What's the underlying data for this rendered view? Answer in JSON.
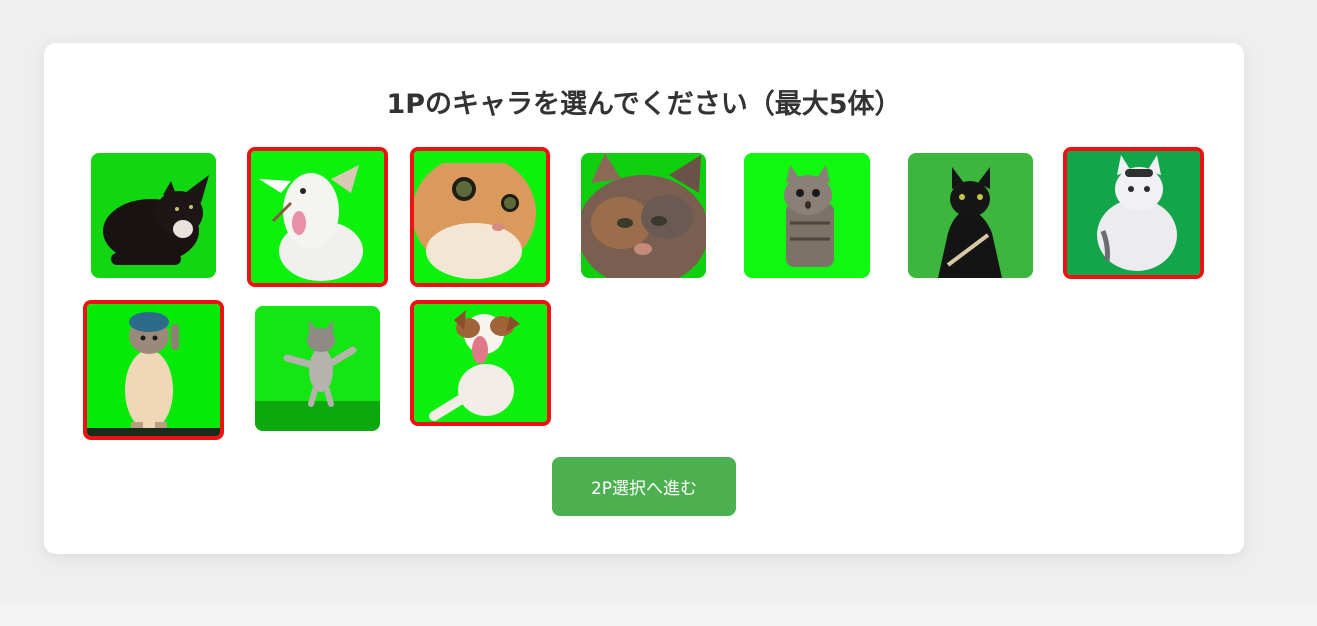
{
  "page": {
    "title": "1Pのキャラを選んでください（最大5体）",
    "next_button_label": "2P選択へ進む",
    "max_selection": 5
  },
  "characters": [
    {
      "id": 1,
      "name": "black-cat-lying-icon",
      "selected": false,
      "bg": "#11d611"
    },
    {
      "id": 2,
      "name": "goat-tongue-icon",
      "selected": true,
      "bg": "#0cf20c"
    },
    {
      "id": 3,
      "name": "orange-cat-closeup-icon",
      "selected": true,
      "bg": "#0cf20c"
    },
    {
      "id": 4,
      "name": "tortoiseshell-cat-face-icon",
      "selected": false,
      "bg": "#0fcf0f"
    },
    {
      "id": 5,
      "name": "tabby-kitten-shocked-icon",
      "selected": false,
      "bg": "#10f810"
    },
    {
      "id": 6,
      "name": "black-cat-sitting-icon",
      "selected": false,
      "bg": "#3db63d"
    },
    {
      "id": 7,
      "name": "white-cat-sitting-icon",
      "selected": true,
      "bg": "#12a54a"
    },
    {
      "id": 8,
      "name": "cat-with-cap-standing-icon",
      "selected": true,
      "bg": "#07ea07"
    },
    {
      "id": 9,
      "name": "small-kitten-dancing-icon",
      "selected": false,
      "bg": "#14e614"
    },
    {
      "id": 10,
      "name": "jack-russell-dog-icon",
      "selected": true,
      "bg": "#0df00d"
    }
  ]
}
